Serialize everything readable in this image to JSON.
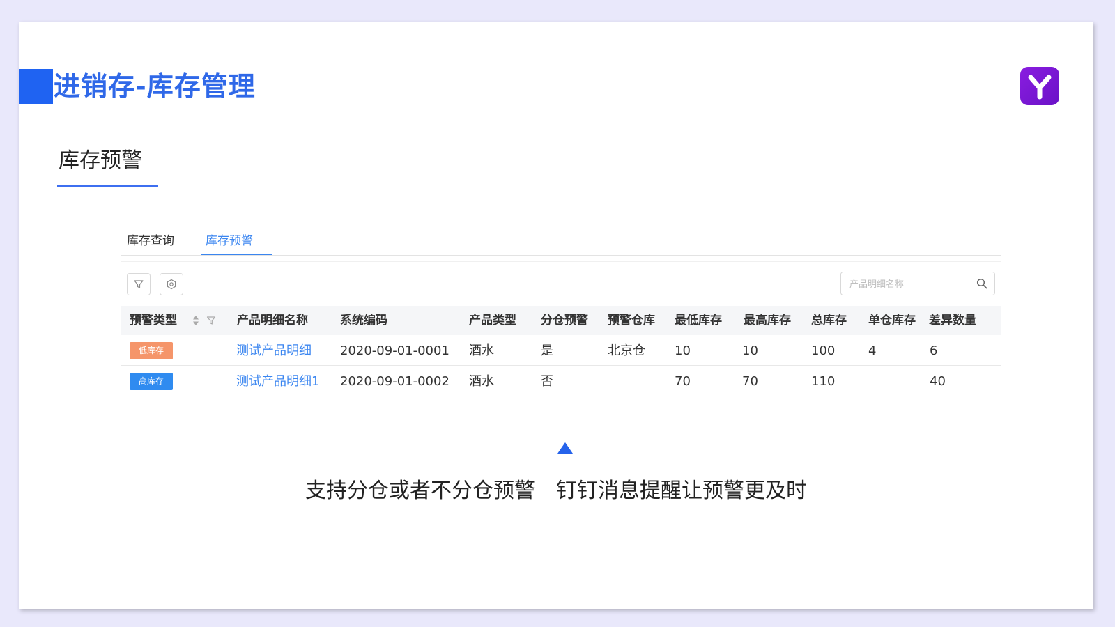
{
  "title": "进销存-库存管理",
  "section_title": "库存预警",
  "colors": {
    "accent": "#1f63f2",
    "title_text": "#2f68e8",
    "link": "#3b86f0",
    "low_stock_badge": "#f5956a",
    "high_stock_badge": "#2f8bf0",
    "logo": "#7a18d6"
  },
  "app": {
    "tabs": [
      {
        "label": "库存查询",
        "active": false
      },
      {
        "label": "库存预警",
        "active": true
      }
    ],
    "toolbar": {
      "filter_icon": "filter-icon",
      "settings_icon": "gear-icon",
      "search_placeholder": "产品明细名称",
      "search_icon": "search-icon"
    },
    "table": {
      "columns": [
        "预警类型",
        "产品明细名称",
        "系统编码",
        "产品类型",
        "分仓预警",
        "预警仓库",
        "最低库存",
        "最高库存",
        "总库存",
        "单仓库存",
        "差异数量"
      ],
      "rows": [
        {
          "alert_type": "低库存",
          "product_name": "测试产品明细",
          "system_code": "2020-09-01-0001",
          "product_type": "酒水",
          "warehouse_alert": "是",
          "alert_warehouse": "北京仓",
          "min_stock": "10",
          "max_stock": "10",
          "total_stock": "100",
          "single_stock": "4",
          "difference": "6"
        },
        {
          "alert_type": "高库存",
          "product_name": "测试产品明细1",
          "system_code": "2020-09-01-0002",
          "product_type": "酒水",
          "warehouse_alert": "否",
          "alert_warehouse": "",
          "min_stock": "70",
          "max_stock": "70",
          "total_stock": "110",
          "single_stock": "",
          "difference": "40"
        }
      ]
    }
  },
  "caption": "支持分仓或者不分仓预警　钉钉消息提醒让预警更及时"
}
